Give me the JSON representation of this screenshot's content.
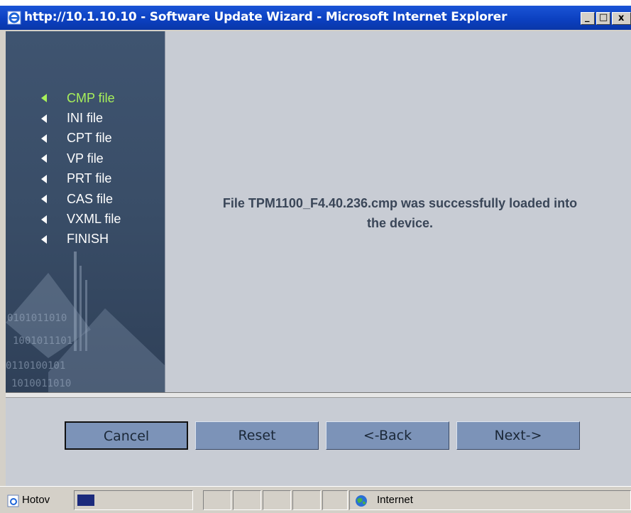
{
  "window": {
    "title": "http://10.1.10.10 - Software Update Wizard - Microsoft Internet Explorer",
    "controls": {
      "minimize": "_",
      "maximize": "□",
      "close": "x"
    }
  },
  "sidebar": {
    "items": [
      {
        "label": "CMP file",
        "active": true
      },
      {
        "label": "INI file",
        "active": false
      },
      {
        "label": "CPT file",
        "active": false
      },
      {
        "label": "VP file",
        "active": false
      },
      {
        "label": "PRT file",
        "active": false
      },
      {
        "label": "CAS file",
        "active": false
      },
      {
        "label": "VXML file",
        "active": false
      },
      {
        "label": "FINISH",
        "active": false
      }
    ],
    "active_color": "#a8f05a"
  },
  "main": {
    "message_line1": "File TPM1100_F4.40.236.cmp was successfully loaded into",
    "message_line2": "the device."
  },
  "buttons": {
    "cancel": "Cancel",
    "reset": "Reset",
    "back": "<-Back",
    "next": "Next->"
  },
  "statusbar": {
    "page_text": "Hotov",
    "zone_text": "Internet"
  },
  "colors": {
    "titlebar": "#0b3fbf",
    "sidebar": "#394d67",
    "button": "#7c93b8",
    "panel": "#c8ccd4"
  }
}
